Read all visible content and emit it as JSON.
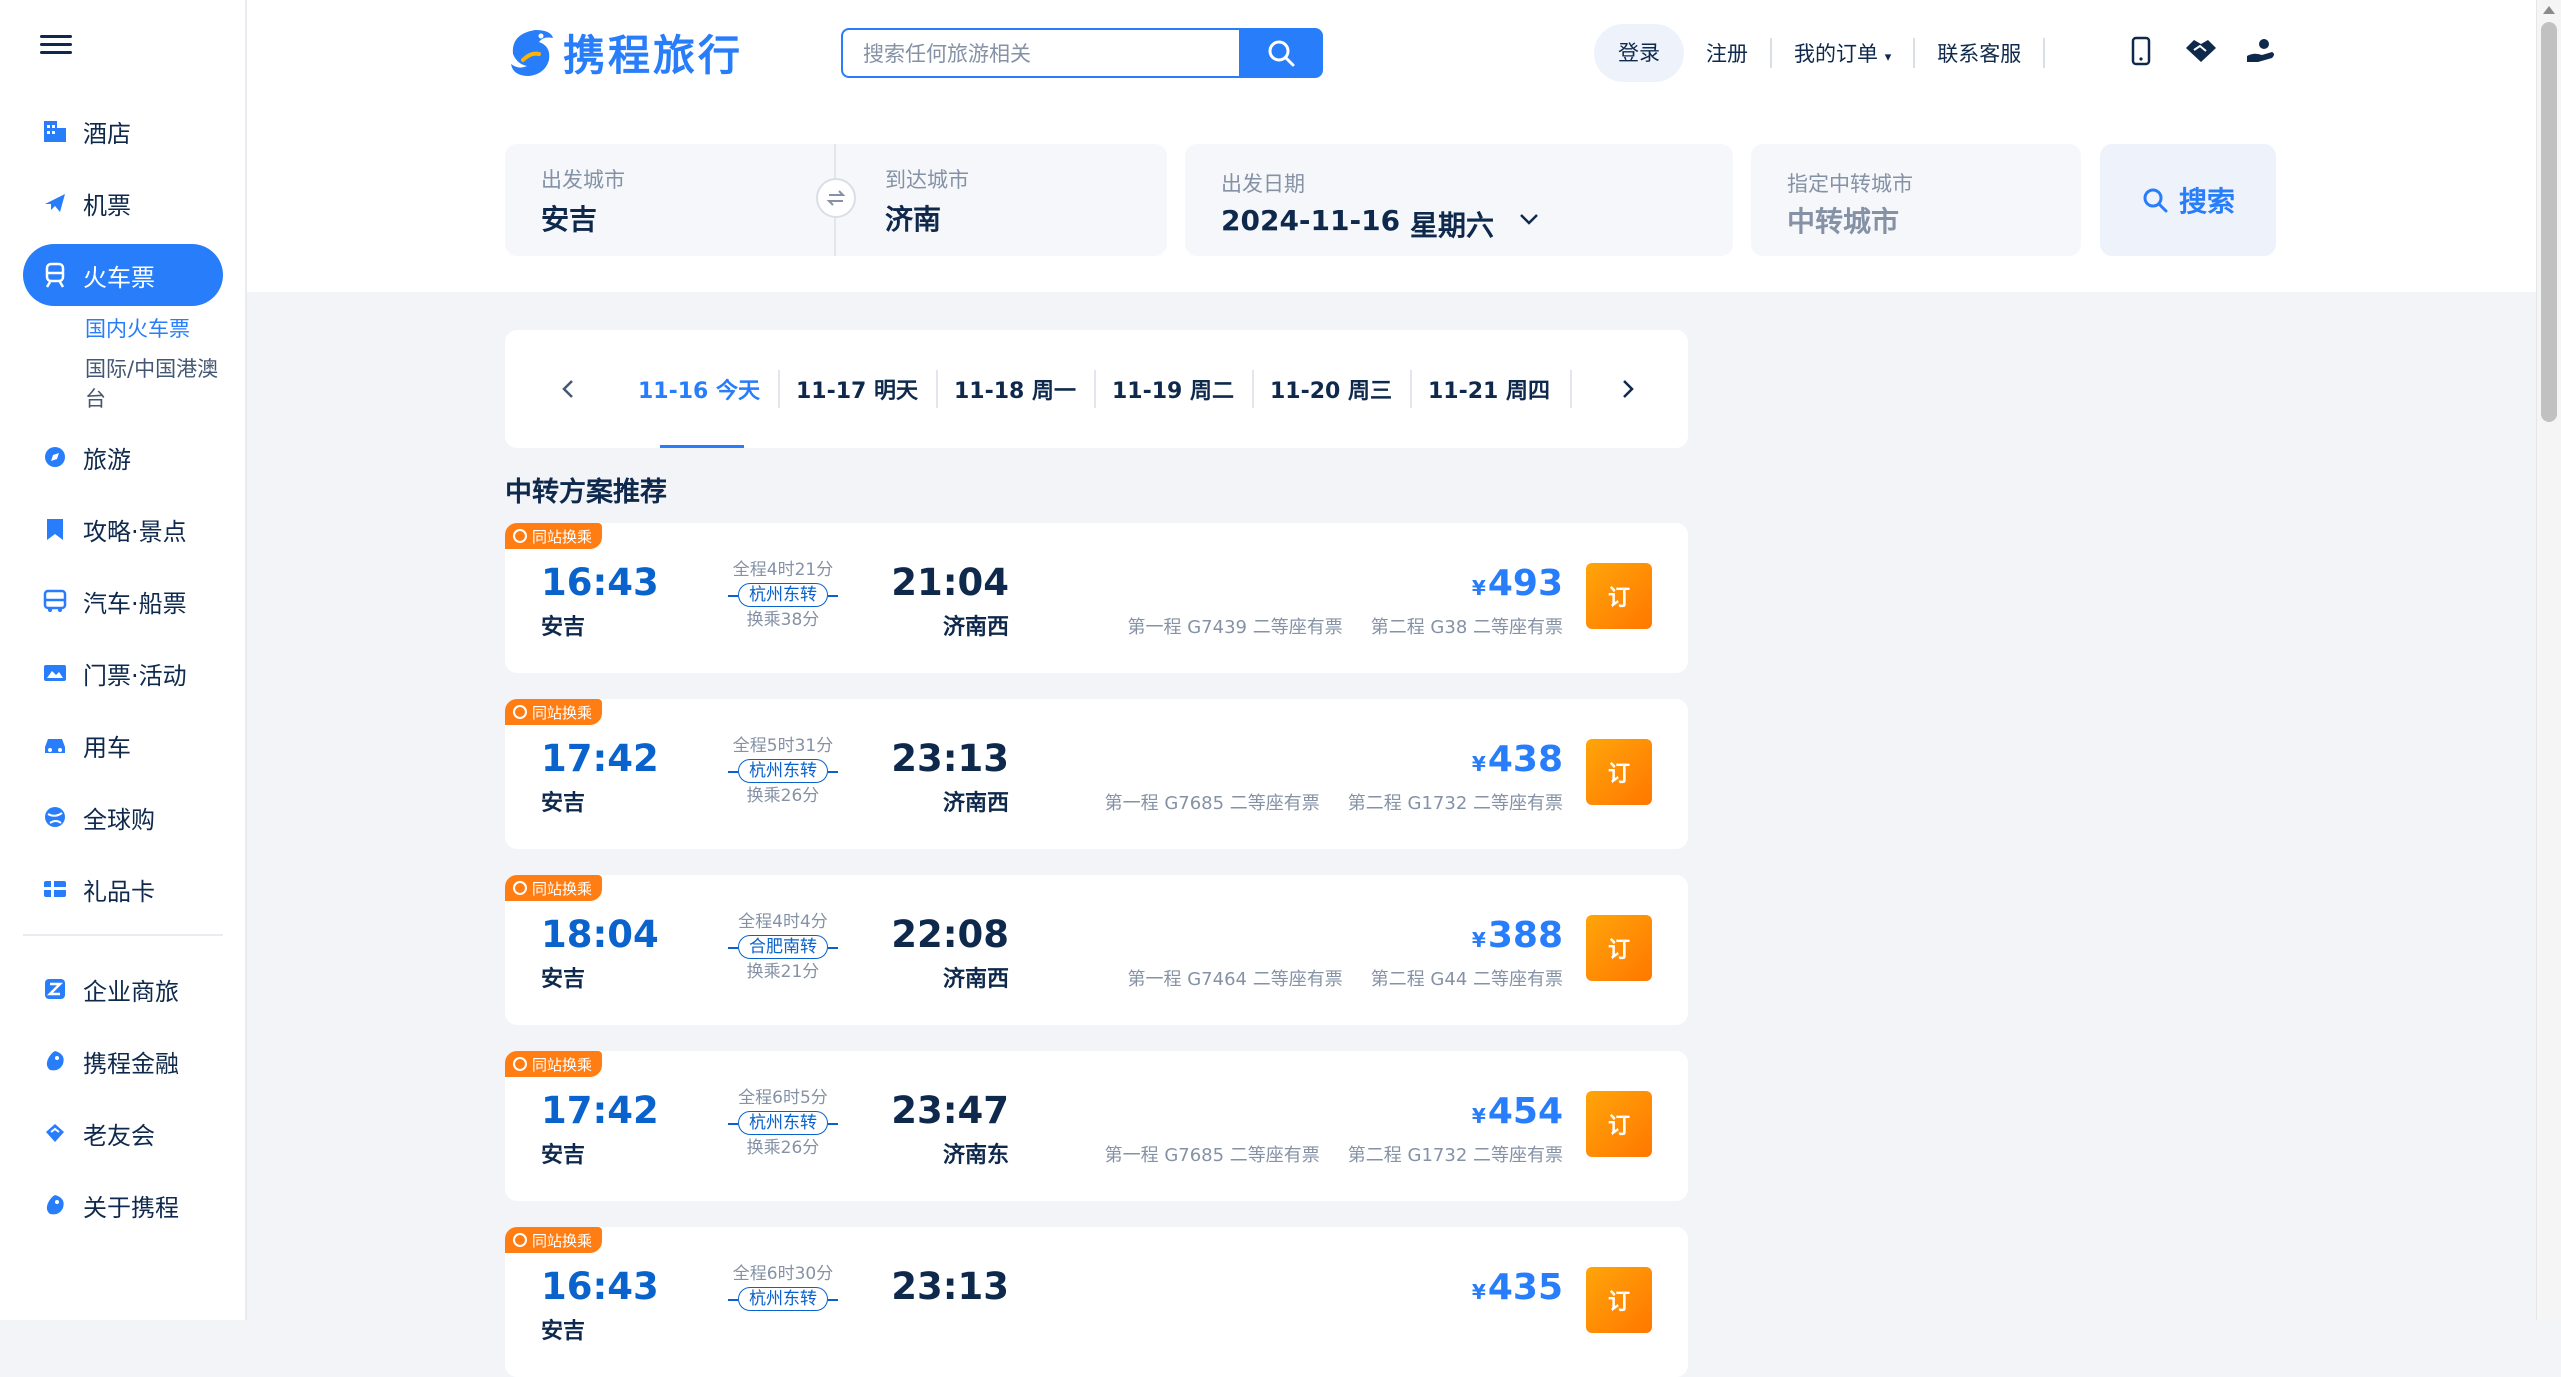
{
  "sidebar": {
    "items": [
      {
        "label": "酒店",
        "icon": "hotel-icon"
      },
      {
        "label": "机票",
        "icon": "plane-icon"
      },
      {
        "label": "火车票",
        "icon": "train-icon",
        "active": true
      },
      {
        "label": "旅游",
        "icon": "compass-icon"
      },
      {
        "label": "攻略·景点",
        "icon": "bookmark-icon"
      },
      {
        "label": "汽车·船票",
        "icon": "bus-icon"
      },
      {
        "label": "门票·活动",
        "icon": "ticket-icon"
      },
      {
        "label": "用车",
        "icon": "car-icon"
      },
      {
        "label": "全球购",
        "icon": "globe-icon"
      },
      {
        "label": "礼品卡",
        "icon": "giftcard-icon"
      }
    ],
    "sub_items": [
      "国内火车票",
      "国际/中国港澳台"
    ],
    "bottom_items": [
      {
        "label": "企业商旅",
        "icon": "business-icon"
      },
      {
        "label": "携程金融",
        "icon": "finance-icon"
      },
      {
        "label": "老友会",
        "icon": "club-icon"
      },
      {
        "label": "关于携程",
        "icon": "about-icon"
      }
    ]
  },
  "header": {
    "logo_text": "携程旅行",
    "search_placeholder": "搜索任何旅游相关",
    "links": {
      "login": "登录",
      "register": "注册",
      "orders": "我的订单",
      "service": "联系客服"
    }
  },
  "form": {
    "from_label": "出发城市",
    "from_value": "安吉",
    "to_label": "到达城市",
    "to_value": "济南",
    "date_label": "出发日期",
    "date_value": "2024-11-16",
    "weekday": "星期六",
    "transfer_label": "指定中转城市",
    "transfer_placeholder": "中转城市",
    "search_label": "搜索"
  },
  "dates": [
    {
      "label": "11-16 今天",
      "selected": true
    },
    {
      "label": "11-17 明天"
    },
    {
      "label": "11-18 周一"
    },
    {
      "label": "11-19 周二"
    },
    {
      "label": "11-20 周三"
    },
    {
      "label": "11-21 周四"
    }
  ],
  "section_title": "中转方案推荐",
  "results": [
    {
      "badge": "同站换乘",
      "dep_time": "16:43",
      "dep_station": "安吉",
      "duration": "全程4时21分",
      "transfer": "杭州东转",
      "wait": "换乘38分",
      "arr_time": "21:04",
      "arr_station": "济南西",
      "currency": "¥",
      "price": "493",
      "leg1": "第一程 G7439 二等座有票",
      "leg2": "第二程 G38 二等座有票",
      "book": "订"
    },
    {
      "badge": "同站换乘",
      "dep_time": "17:42",
      "dep_station": "安吉",
      "duration": "全程5时31分",
      "transfer": "杭州东转",
      "wait": "换乘26分",
      "arr_time": "23:13",
      "arr_station": "济南西",
      "currency": "¥",
      "price": "438",
      "leg1": "第一程 G7685 二等座有票",
      "leg2": "第二程 G1732 二等座有票",
      "book": "订"
    },
    {
      "badge": "同站换乘",
      "dep_time": "18:04",
      "dep_station": "安吉",
      "duration": "全程4时4分",
      "transfer": "合肥南转",
      "wait": "换乘21分",
      "arr_time": "22:08",
      "arr_station": "济南西",
      "currency": "¥",
      "price": "388",
      "leg1": "第一程 G7464 二等座有票",
      "leg2": "第二程 G44 二等座有票",
      "book": "订"
    },
    {
      "badge": "同站换乘",
      "dep_time": "17:42",
      "dep_station": "安吉",
      "duration": "全程6时5分",
      "transfer": "杭州东转",
      "wait": "换乘26分",
      "arr_time": "23:47",
      "arr_station": "济南东",
      "currency": "¥",
      "price": "454",
      "leg1": "第一程 G7685 二等座有票",
      "leg2": "第二程 G1732 二等座有票",
      "book": "订"
    },
    {
      "badge": "同站换乘",
      "dep_time": "16:43",
      "dep_station": "安吉",
      "duration": "全程6时30分",
      "transfer": "杭州东转",
      "wait": "",
      "arr_time": "23:13",
      "arr_station": "",
      "currency": "¥",
      "price": "435",
      "leg1": "",
      "leg2": "",
      "book": "订"
    }
  ],
  "colors": {
    "brand": "#287dfa",
    "time_blue": "#0a62cc",
    "badge_orange": "#ff7d13",
    "book_orange": "#ff8c00"
  }
}
